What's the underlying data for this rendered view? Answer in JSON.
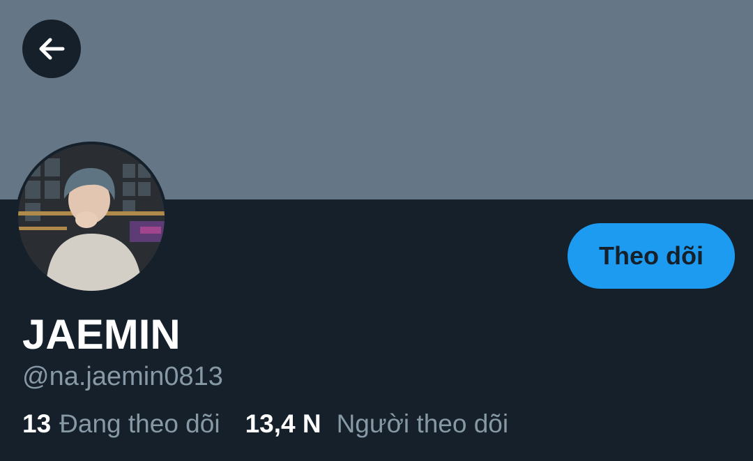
{
  "header": {
    "back_icon": "arrow-left-icon"
  },
  "colors": {
    "banner": "#657786",
    "background": "#15202b",
    "accent": "#1d9bf0",
    "secondary_text": "#8899a6",
    "primary_text": "#ffffff"
  },
  "profile": {
    "display_name": "JAEMIN",
    "handle": "@na.jaemin0813",
    "follow_label": "Theo dõi"
  },
  "stats": {
    "following_count": "13",
    "following_label": "Đang theo dõi",
    "followers_count": "13,4 N",
    "followers_label": "Người theo dõi"
  }
}
